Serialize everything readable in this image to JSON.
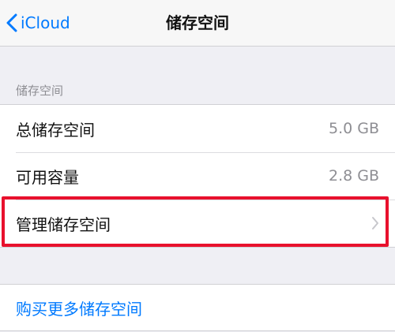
{
  "navbar": {
    "back_label": "iCloud",
    "title": "储存空间"
  },
  "storage_section": {
    "header": "储存空间",
    "rows": [
      {
        "label": "总储存空间",
        "value": "5.0 GB"
      },
      {
        "label": "可用容量",
        "value": "2.8 GB"
      },
      {
        "label": "管理储存空间"
      }
    ]
  },
  "purchase": {
    "label": "购买更多储存空间"
  },
  "colors": {
    "accent": "#007aff",
    "highlight": "#e8112d",
    "background": "#efeff4"
  },
  "icons": {
    "back": "chevron-left-icon",
    "disclosure": "chevron-right-icon"
  }
}
